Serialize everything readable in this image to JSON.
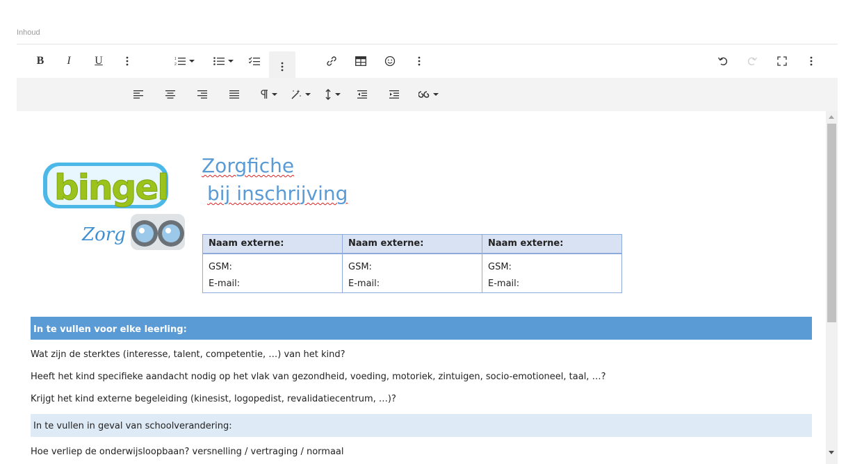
{
  "field": {
    "label": "Inhoud"
  },
  "toolbar": {
    "bold": "B",
    "italic": "I",
    "underline": "U"
  },
  "document": {
    "title_line1": "Zorgfiche",
    "title_line2": "bij inschrijving",
    "logo": {
      "brand_text": "bingel",
      "sub_text": "Zorg"
    },
    "contact_table": {
      "headers": [
        "Naam externe:",
        "Naam externe:",
        "Naam externe:"
      ],
      "gsm_label": "GSM:",
      "email_label": "E-mail:"
    },
    "section1": {
      "heading": "In te vullen voor elke leerling:",
      "questions": [
        "Wat zijn de sterktes (interesse, talent, competentie, …) van het kind?",
        "Heeft het kind specifieke aandacht nodig op het vlak van gezondheid, voeding, motoriek, zintuigen, socio-emotioneel, taal, …?",
        "Krijgt het kind externe begeleiding (kinesist, logopedist, revalidatiecentrum, …)?"
      ]
    },
    "section2": {
      "heading": "In te vullen in geval van schoolverandering:",
      "questions": [
        "Hoe verliep de onderwijsloopbaan? versnelling / vertraging / normaal"
      ]
    }
  },
  "colors": {
    "accent_blue": "#5b9bd5",
    "light_blue": "#deeaf6",
    "table_header": "#d9e2f3"
  }
}
